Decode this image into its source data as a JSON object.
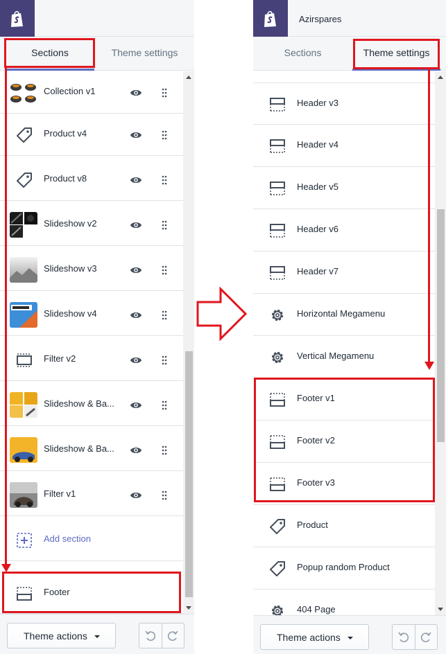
{
  "left": {
    "tabs": {
      "sections": "Sections",
      "theme_settings": "Theme settings"
    },
    "items": [
      {
        "label": "Collection v1",
        "icon": "collection-thumbnail"
      },
      {
        "label": "Product v4",
        "icon": "tag-icon"
      },
      {
        "label": "Product v8",
        "icon": "tag-icon"
      },
      {
        "label": "Slideshow v2",
        "icon": "slideshow-thumbnail"
      },
      {
        "label": "Slideshow v3",
        "icon": "slideshow-thumbnail"
      },
      {
        "label": "Slideshow v4",
        "icon": "slideshow-thumbnail"
      },
      {
        "label": "Filter v2",
        "icon": "section-icon"
      },
      {
        "label": "Slideshow & Ba...",
        "icon": "banner-thumbnail"
      },
      {
        "label": "Slideshow & Ba...",
        "icon": "banner-thumbnail"
      },
      {
        "label": "Filter v1",
        "icon": "filter-thumbnail"
      }
    ],
    "add_section": "Add section",
    "footer": "Footer",
    "theme_actions": "Theme actions"
  },
  "right": {
    "store_name": "Azirspares",
    "tabs": {
      "sections": "Sections",
      "theme_settings": "Theme settings"
    },
    "items": [
      {
        "label": "Header v3",
        "icon": "header-layout-icon"
      },
      {
        "label": "Header v4",
        "icon": "header-layout-icon"
      },
      {
        "label": "Header v5",
        "icon": "header-layout-icon"
      },
      {
        "label": "Header v6",
        "icon": "header-layout-icon"
      },
      {
        "label": "Header v7",
        "icon": "header-layout-icon"
      },
      {
        "label": "Horizontal Megamenu",
        "icon": "gear-icon"
      },
      {
        "label": "Vertical Megamenu",
        "icon": "gear-icon"
      },
      {
        "label": "Footer v1",
        "icon": "footer-layout-icon"
      },
      {
        "label": "Footer v2",
        "icon": "footer-layout-icon"
      },
      {
        "label": "Footer v3",
        "icon": "footer-layout-icon"
      },
      {
        "label": "Product",
        "icon": "tag-icon"
      },
      {
        "label": "Popup random Product",
        "icon": "tag-icon"
      },
      {
        "label": "404 Page",
        "icon": "gear-icon"
      }
    ],
    "theme_actions": "Theme actions"
  },
  "colors": {
    "brand": "#47417a",
    "accent": "#5c6ac4",
    "highlight": "#e0161e"
  }
}
